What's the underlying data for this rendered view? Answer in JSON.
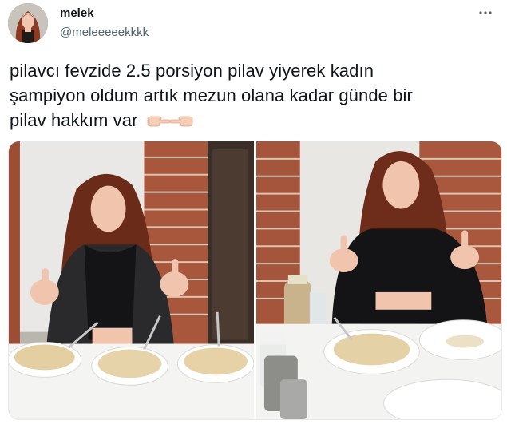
{
  "author": {
    "display_name": "melek",
    "handle": "@meleeeeekkkk",
    "avatar_icon": "profile-photo"
  },
  "tweet": {
    "text_line1": "pilavcı fevzide 2.5 porsiyon pilav yiyerek kadın",
    "text_line2": "şampiyon oldum artık mezun olana kadar günde bir",
    "text_line3": "pilav hakkım var",
    "emoji_icons": [
      "backhand-index-pointing-right-icon",
      "backhand-index-pointing-left-icon"
    ]
  },
  "actions": {
    "more_icon": "more-horizontal-icon"
  },
  "media": {
    "photos": [
      {
        "name": "photo-left",
        "description_icon": "photo"
      },
      {
        "name": "photo-right",
        "description_icon": "photo"
      }
    ]
  },
  "colors": {
    "text": "#0f1419",
    "secondary": "#536471",
    "border": "#e6e9ec"
  }
}
